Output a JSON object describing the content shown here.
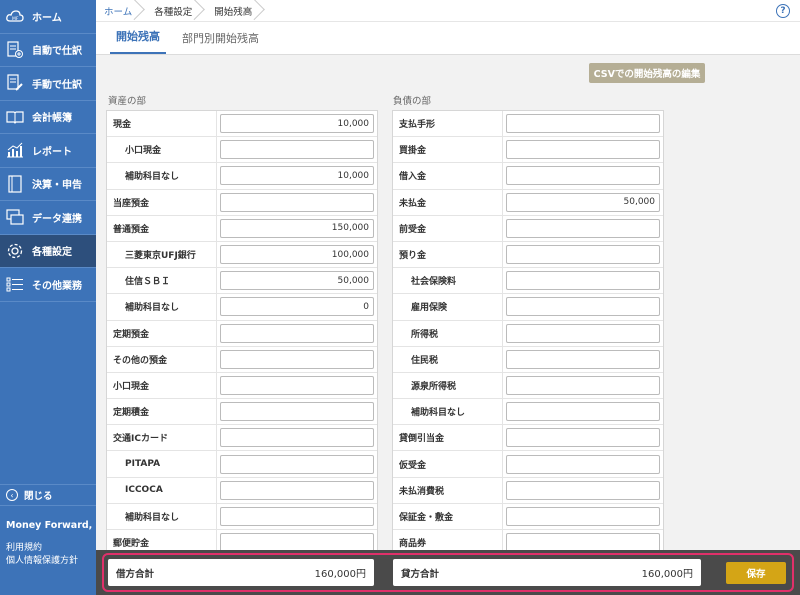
{
  "sidebar": {
    "items": [
      {
        "label": "ホーム",
        "icon": "cloud-mf-icon"
      },
      {
        "label": "自動で仕訳",
        "icon": "document-plus-icon"
      },
      {
        "label": "手動で仕訳",
        "icon": "document-pen-icon"
      },
      {
        "label": "会計帳簿",
        "icon": "book-icon"
      },
      {
        "label": "レポート",
        "icon": "chart-icon"
      },
      {
        "label": "決算・申告",
        "icon": "file-icon"
      },
      {
        "label": "データ連携",
        "icon": "data-link-icon"
      },
      {
        "label": "各種設定",
        "icon": "gear-icon"
      },
      {
        "label": "その他業務",
        "icon": "list-icon"
      }
    ],
    "close_label": "閉じる",
    "company": "Money Forward, Inc.",
    "links": [
      "利用規約",
      "個人情報保護方針"
    ]
  },
  "breadcrumb": [
    "ホーム",
    "各種設定",
    "開始残高"
  ],
  "tabs": [
    "開始残高",
    "部門別開始残高"
  ],
  "csv_button": "CSVでの開始残高の編集",
  "assets": {
    "title": "資産の部",
    "rows": [
      {
        "name": "現金",
        "value": "10,000"
      },
      {
        "name": "小口現金",
        "value": ""
      },
      {
        "name": "補助科目なし",
        "value": "10,000"
      },
      {
        "name": "当座預金",
        "value": ""
      },
      {
        "name": "普通預金",
        "value": "150,000"
      },
      {
        "name": "三菱東京UFJ銀行",
        "value": "100,000"
      },
      {
        "name": "住信ＳＢＩ",
        "value": "50,000"
      },
      {
        "name": "補助科目なし",
        "value": "0"
      },
      {
        "name": "定期預金",
        "value": ""
      },
      {
        "name": "その他の預金",
        "value": ""
      },
      {
        "name": "小口現金",
        "value": ""
      },
      {
        "name": "定期積金",
        "value": ""
      },
      {
        "name": "交通ICカード",
        "value": ""
      },
      {
        "name": "PITAPA",
        "value": ""
      },
      {
        "name": "ICCOCA",
        "value": ""
      },
      {
        "name": "補助科目なし",
        "value": ""
      },
      {
        "name": "郵便貯金",
        "value": ""
      }
    ]
  },
  "liabilities": {
    "title": "負債の部",
    "rows": [
      {
        "name": "支払手形",
        "value": ""
      },
      {
        "name": "買掛金",
        "value": ""
      },
      {
        "name": "借入金",
        "value": ""
      },
      {
        "name": "未払金",
        "value": "50,000"
      },
      {
        "name": "前受金",
        "value": ""
      },
      {
        "name": "預り金",
        "value": ""
      },
      {
        "name": "社会保険料",
        "value": ""
      },
      {
        "name": "雇用保険",
        "value": ""
      },
      {
        "name": "所得税",
        "value": ""
      },
      {
        "name": "住民税",
        "value": ""
      },
      {
        "name": "源泉所得税",
        "value": ""
      },
      {
        "name": "補助科目なし",
        "value": ""
      },
      {
        "name": "貸倒引当金",
        "value": ""
      },
      {
        "name": "仮受金",
        "value": ""
      },
      {
        "name": "未払消費税",
        "value": ""
      },
      {
        "name": "保証金・敷金",
        "value": ""
      },
      {
        "name": "商品券",
        "value": ""
      }
    ]
  },
  "footer": {
    "debit_label": "借方合計",
    "debit_value": "160,000円",
    "credit_label": "貸方合計",
    "credit_value": "160,000円",
    "save_label": "保存"
  },
  "colors": {
    "sidebar": "#3d73b8",
    "active": "#2d4f7c",
    "accent": "#d4a516",
    "highlight": "#e0306a"
  }
}
